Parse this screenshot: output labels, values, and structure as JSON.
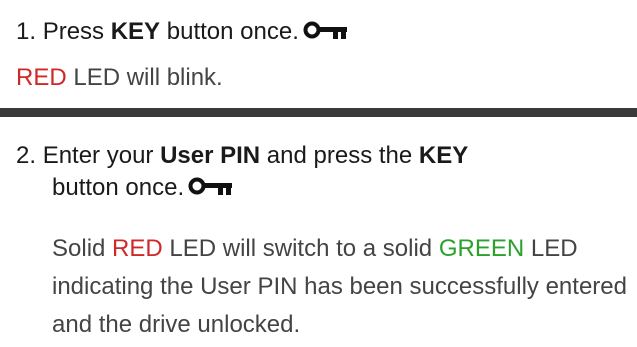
{
  "step1": {
    "number": "1.",
    "text_before": "Press",
    "bold": "KEY",
    "text_after": "button once.",
    "icon": "key-icon",
    "note": {
      "led": "RED",
      "rest": "LED will blink."
    }
  },
  "step2": {
    "number": "2.",
    "text_a": "Enter your",
    "bold_a": "User PIN",
    "text_b": "and press the",
    "bold_b": "KEY",
    "line2": "button once.",
    "icon": "key-icon",
    "note": {
      "t1": "Solid",
      "led1": "RED",
      "t2": "LED will switch to a solid",
      "led2": "GREEN",
      "t3": "LED indicating the User PIN has been successfully entered and the drive unlocked."
    }
  },
  "colors": {
    "red": "#d02828",
    "green": "#2aa12a",
    "divider": "#3a3a3a",
    "text": "#1a1a1a",
    "note_text": "#444444"
  }
}
